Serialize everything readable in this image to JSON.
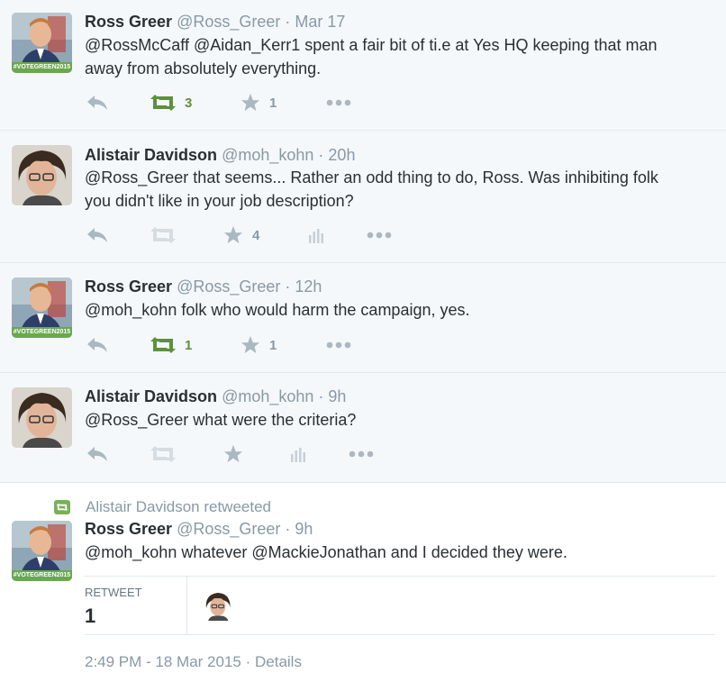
{
  "tweets": [
    {
      "fullname": "Ross Greer",
      "screen_name": "@Ross_Greer",
      "time": "· Mar 17",
      "text_lines": [
        "@RossMcCaff @Aidan_Kerr1 spent a fair bit of ti.e at Yes HQ keeping that man",
        "away from absolutely everything."
      ],
      "retweet_count": "3",
      "favorite_count": "1",
      "retweeted": true,
      "avatar": "ross-greer",
      "avatar_badge": "#VOTEGREEN2015"
    },
    {
      "fullname": "Alistair Davidson",
      "screen_name": "@moh_kohn",
      "time": "· 20h",
      "text_lines": [
        "@Ross_Greer that seems... Rather an odd thing to do, Ross. Was inhibiting folk",
        "you didn't like in your job description?"
      ],
      "retweet_count": "",
      "favorite_count": "4",
      "retweeted": false,
      "avatar": "alistair-davidson"
    },
    {
      "fullname": "Ross Greer",
      "screen_name": "@Ross_Greer",
      "time": "· 12h",
      "text_lines": [
        "@moh_kohn folk who would harm the campaign, yes."
      ],
      "retweet_count": "1",
      "favorite_count": "1",
      "retweeted": true,
      "avatar": "ross-greer",
      "avatar_badge": "#VOTEGREEN2015"
    },
    {
      "fullname": "Alistair Davidson",
      "screen_name": "@moh_kohn",
      "time": "· 9h",
      "text_lines": [
        "@Ross_Greer what were the criteria?"
      ],
      "retweet_count": "",
      "favorite_count": "",
      "retweeted": false,
      "avatar": "alistair-davidson"
    }
  ],
  "focused": {
    "retweeted_by": "Alistair Davidson retweeted",
    "fullname": "Ross Greer",
    "screen_name": "@Ross_Greer",
    "time": "· 9h",
    "text": "@moh_kohn whatever @MackieJonathan and I decided they were.",
    "stats": {
      "label": "RETWEET",
      "value": "1"
    },
    "timestamp": "2:49 PM - 18 Mar 2015",
    "details_link": "· Details",
    "avatar_badge": "#VOTEGREEN2015"
  },
  "colors": {
    "retweet_green": "#5c913b",
    "action_gray": "#aab8c2",
    "muted_text": "#8899a6",
    "reply_bg": "#f5f8fa",
    "badge_green": "#6aa84f"
  },
  "icons": [
    "reply-icon",
    "retweet-icon",
    "favorite-star-icon",
    "analytics-icon",
    "more-icon"
  ]
}
